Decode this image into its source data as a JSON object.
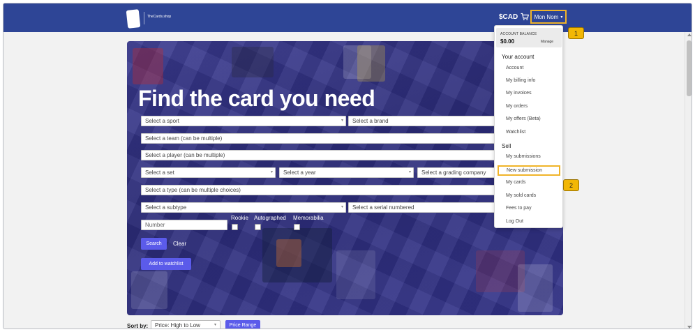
{
  "header": {
    "logo_text": "TheCards.shop",
    "currency": "$CAD",
    "cart_icon": "cart-icon",
    "user_name": "Mon Nom",
    "user_chevron": "▾"
  },
  "hero": {
    "title": "Find the card you need",
    "filters": {
      "sport": "Select a sport",
      "brand": "Select a brand",
      "team": "Select a team (can be multiple)",
      "player": "Select a player (can be multiple)",
      "set": "Select a set",
      "year": "Select a year",
      "grading_company": "Select a grading company",
      "type": "Select a type (can be multiple choices)",
      "subtype": "Select a subtype",
      "serial": "Select a serial numbered",
      "number_placeholder": "Number"
    },
    "checkboxes": {
      "rookie": "Rookie",
      "autographed": "Autographed",
      "memorabilia": "Memorabilia"
    },
    "search_label": "Search",
    "clear_label": "Clear",
    "watchlist_label": "Add to watchlist"
  },
  "account_menu": {
    "balance_label": "ACCOUNT BALANCE",
    "balance_amount": "$0.00",
    "manage_label": "Manage",
    "your_account_heading": "Your account",
    "account_items": [
      "Account",
      "My billing info",
      "My invoices",
      "My orders",
      "My offers (Beta)",
      "Watchlist"
    ],
    "sell_heading": "Sell",
    "sell_items": [
      "My submissions",
      "New submission",
      "My cards",
      "My sold cards",
      "Fees to pay",
      "Log Out"
    ]
  },
  "annotations": {
    "step1": "1",
    "step2": "2",
    "highlight_color": "#f0b429"
  },
  "sort": {
    "label": "Sort by:",
    "selected": "Price: High to Low",
    "price_range_label": "Price Range"
  },
  "colors": {
    "header_bg": "#2e4596",
    "button_accent": "#5b5bea"
  }
}
